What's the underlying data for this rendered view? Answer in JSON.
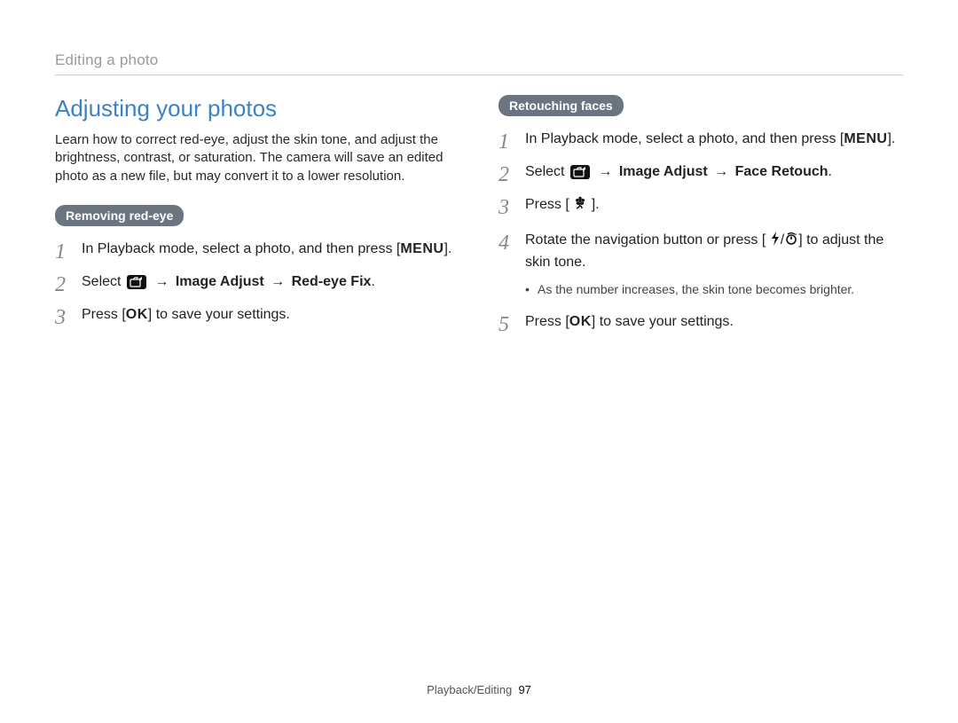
{
  "header": {
    "breadcrumb": "Editing a photo"
  },
  "heading": "Adjusting your photos",
  "intro": "Learn how to correct red-eye, adjust the skin tone, and adjust the brightness, contrast, or saturation. The camera will save an edited photo as a new file, but may convert it to a lower resolution.",
  "left": {
    "pill": "Removing red-eye",
    "step1_a": "In Playback mode, select a photo, and then press [",
    "step1_menu": "MENU",
    "step1_b": "].",
    "step2_a": "Select ",
    "step2_path_arrow1": " → ",
    "step2_path_b": "Image Adjust",
    "step2_path_arrow2": " → ",
    "step2_path_c": "Red-eye Fix",
    "step2_end": ".",
    "step3_a": "Press [",
    "step3_ok": "OK",
    "step3_b": "] to save your settings."
  },
  "right": {
    "pill": "Retouching faces",
    "step1_a": "In Playback mode, select a photo, and then press [",
    "step1_menu": "MENU",
    "step1_b": "].",
    "step2_a": "Select ",
    "step2_path_arrow1": " → ",
    "step2_path_b": "Image Adjust",
    "step2_path_arrow2": " → ",
    "step2_path_c": "Face Retouch",
    "step2_end": ".",
    "step3_a": "Press [",
    "step3_b": "].",
    "step4_a": "Rotate the navigation button or press [",
    "step4_sep": "/",
    "step4_b": "] to adjust the skin tone.",
    "bullet": "As the number increases, the skin tone becomes brighter.",
    "step5_a": "Press [",
    "step5_ok": "OK",
    "step5_b": "] to save your settings."
  },
  "footer": {
    "section": "Playback/Editing",
    "page": "97"
  },
  "icons": {
    "edit_tab": "edit-tab-icon",
    "macro": "macro-flower-icon",
    "flash": "flash-icon",
    "timer": "self-timer-icon"
  }
}
